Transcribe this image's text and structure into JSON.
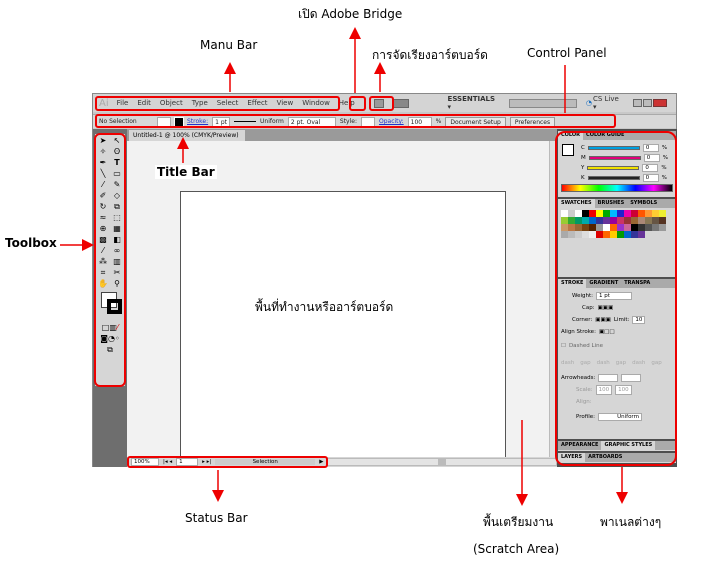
{
  "annotations": {
    "bridge": "เปิด Adobe Bridge",
    "menu_bar": "Manu Bar",
    "arrange": "การจัดเรียงอาร์ตบอร์ด",
    "control_panel": "Control Panel",
    "title_bar": "Title Bar",
    "toolbox": "Toolbox",
    "artboard": "พื้นที่ทำงานหรืออาร์ตบอร์ด",
    "status_bar": "Status Bar",
    "scratch_th": "พื้นเตรียมงาน",
    "scratch_en": "(Scratch Area)",
    "panels": "พาเนลต่างๆ"
  },
  "app": {
    "logo": "Ai",
    "menu": [
      "File",
      "Edit",
      "Object",
      "Type",
      "Select",
      "Effect",
      "View",
      "Window",
      "Help"
    ],
    "workspace": "ESSENTIALS ▾",
    "cs_live": "CS Live ▾",
    "annotation_color": "#e00000"
  },
  "control": {
    "selection": "No Selection",
    "stroke_label": "Stroke:",
    "stroke_value": "1 pt",
    "profile": "Uniform",
    "brush": "2 pt. Oval",
    "style_label": "Style:",
    "opacity_label": "Opacity:",
    "opacity_value": "100",
    "percent": "%",
    "document_setup": "Document Setup",
    "preferences": "Preferences"
  },
  "document": {
    "tab_title": "Untitled-1 @ 100% (CMYK/Preview)",
    "close": "×"
  },
  "status": {
    "zoom": "100%",
    "page": "1",
    "tool": "Selection"
  },
  "panels": {
    "color_tabs": [
      "COLOR",
      "COLOR GUIDE"
    ],
    "channels": [
      {
        "name": "C",
        "value": "0",
        "color": "#00a0e0"
      },
      {
        "name": "M",
        "value": "0",
        "color": "#e0007a"
      },
      {
        "name": "Y",
        "value": "0",
        "color": "#f0e000"
      },
      {
        "name": "K",
        "value": "0",
        "color": "#222222"
      }
    ],
    "swatch_tabs": [
      "SWATCHES",
      "BRUSHES",
      "SYMBOLS"
    ],
    "stroke_tabs": [
      "STROKE",
      "GRADIENT",
      "TRANSPA"
    ],
    "weight_label": "Weight:",
    "weight_value": "1 pt",
    "cap_label": "Cap:",
    "corner_label": "Corner:",
    "limit_label": "Limit:",
    "limit_value": "10",
    "align_label": "Align Stroke:",
    "dashed_label": "Dashed Line",
    "dash_labels": [
      "dash",
      "gap",
      "dash",
      "gap",
      "dash",
      "gap"
    ],
    "arrowheads_label": "Arrowheads:",
    "scale_label": "Scale:",
    "scale1": "100",
    "scale2": "100",
    "align2_label": "Align:",
    "profile_label": "Profile:",
    "profile_value": "Uniform",
    "appearance_tabs": [
      "APPEARANCE",
      "GRAPHIC STYLES"
    ],
    "layers_tabs": [
      "LAYERS",
      "ARTBOARDS"
    ]
  }
}
